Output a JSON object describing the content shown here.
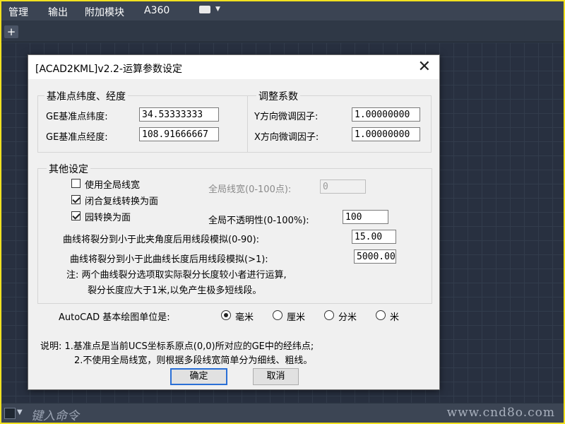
{
  "menubar": {
    "items": [
      "管理",
      "输出",
      "附加模块",
      "A360"
    ]
  },
  "tabstrip": {
    "new_tab": "+"
  },
  "cmdline": {
    "prompt": "键入命令",
    "watermark": "www.cnd8o.com"
  },
  "dialog": {
    "title": "[ACAD2KML]v2.2-运算参数设定",
    "close_glyph": "✕",
    "ref_group": {
      "title": "基准点纬度、经度",
      "lat_label": "GE基准点纬度:",
      "lat_value": "34.53333333",
      "lon_label": "GE基准点经度:",
      "lon_value": "108.91666667"
    },
    "adjust_group": {
      "title": "调整系数",
      "y_label": "Y方向微调因子:",
      "y_value": "1.00000000",
      "x_label": "X方向微调因子:",
      "x_value": "1.00000000"
    },
    "other_group": {
      "title": "其他设定",
      "use_global_width": {
        "label": "使用全局线宽",
        "checked": false
      },
      "closed_polyline": {
        "label": "闭合复线转换为面",
        "checked": true
      },
      "circle_to_face": {
        "label": "园转换为面",
        "checked": true
      },
      "global_width_label": "全局线宽(0-100点):",
      "global_width_value": "0",
      "opacity_label": "全局不透明性(0-100%):",
      "opacity_value": "100",
      "angle_label": "曲线将裂分到小于此夹角度后用线段模拟(0-90):",
      "angle_value": "15.00",
      "length_label": "曲线将裂分到小于此曲线长度后用线段模拟(>1):",
      "length_value": "5000.00",
      "note_line1": "注: 两个曲线裂分选项取实际裂分长度较小者进行运算,",
      "note_line2": "裂分长度应大于1米,以免产生极多短线段。"
    },
    "units": {
      "label": "AutoCAD 基本绘图单位是:",
      "options": [
        "毫米",
        "厘米",
        "分米",
        "米"
      ],
      "selected": "毫米"
    },
    "explain_line1": "说明: 1.基准点是当前UCS坐标系原点(0,0)所对应的GE中的经纬点;",
    "explain_line2": "2.不使用全局线宽，则根据多段线宽简单分为细线、粗线。",
    "ok_label": "确定",
    "cancel_label": "取消"
  }
}
